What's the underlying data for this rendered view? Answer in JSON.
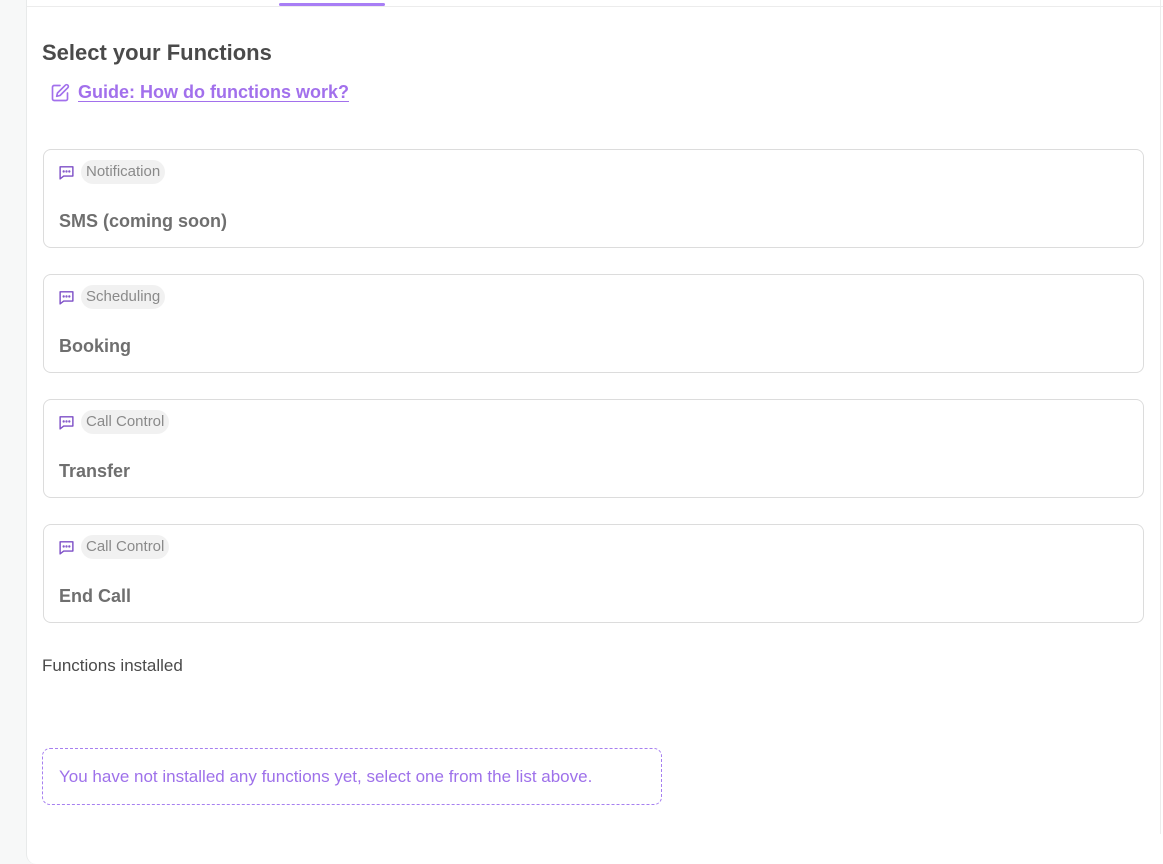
{
  "header": {
    "title": "Select your Functions",
    "guide_link": "Guide: How do functions work?"
  },
  "functions": [
    {
      "category": "Notification",
      "name": "SMS (coming soon)",
      "icon": "message-icon"
    },
    {
      "category": "Scheduling",
      "name": "Booking",
      "icon": "message-icon"
    },
    {
      "category": "Call Control",
      "name": "Transfer",
      "icon": "message-icon"
    },
    {
      "category": "Call Control",
      "name": "End Call",
      "icon": "message-icon"
    }
  ],
  "installed": {
    "heading": "Functions installed",
    "empty_message": "You have not installed any functions yet, select one from the list above."
  },
  "colors": {
    "accent": "#a270ec",
    "text": "#4a4a4a",
    "border": "#dcdcdc"
  }
}
